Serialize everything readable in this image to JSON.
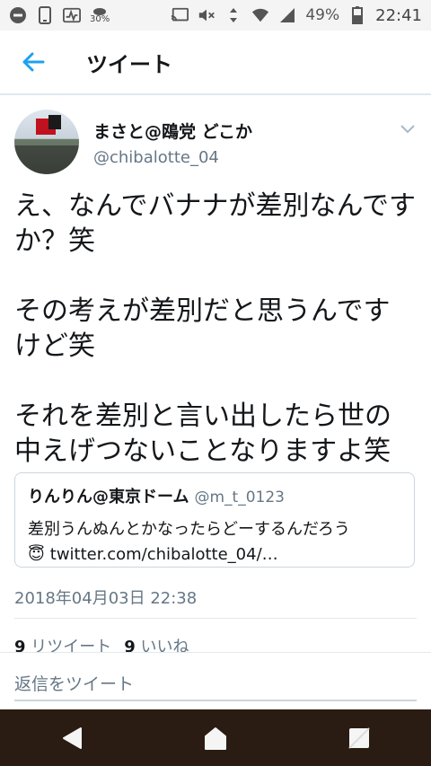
{
  "status_bar": {
    "weather_percent": "30%",
    "battery_percent": "49%",
    "time": "22:41"
  },
  "app_bar": {
    "title": "ツイート",
    "icons": {
      "back": "arrow-left-icon"
    },
    "accent": "#1da1f2"
  },
  "tweet": {
    "author_name": "まさと@鴎党 どこか",
    "author_handle": "@chibalotte_04",
    "text": "え、なんでバナナが差別なんですか？笑\n\nその考えが差別だと思うんですけど笑\n\nそれを差別と言い出したら世の中えげつないことなりますよ笑",
    "timestamp": "2018年04月03日 22:38",
    "retweets": {
      "count": "9",
      "label": "リツイート"
    },
    "likes": {
      "count": "9",
      "label": "いいね"
    }
  },
  "quote": {
    "name": "りんりん@東京ドーム",
    "handle": "@m_t_0123",
    "line1": "差別うんぬんとかなったらどーするんだろう",
    "link": "twitter.com/chibalotte_04/…",
    "emoji": "😇"
  },
  "reply": {
    "placeholder": "返信をツイート"
  },
  "nav": {
    "icons": [
      "nav-back-icon",
      "nav-home-icon",
      "nav-recents-icon"
    ]
  }
}
